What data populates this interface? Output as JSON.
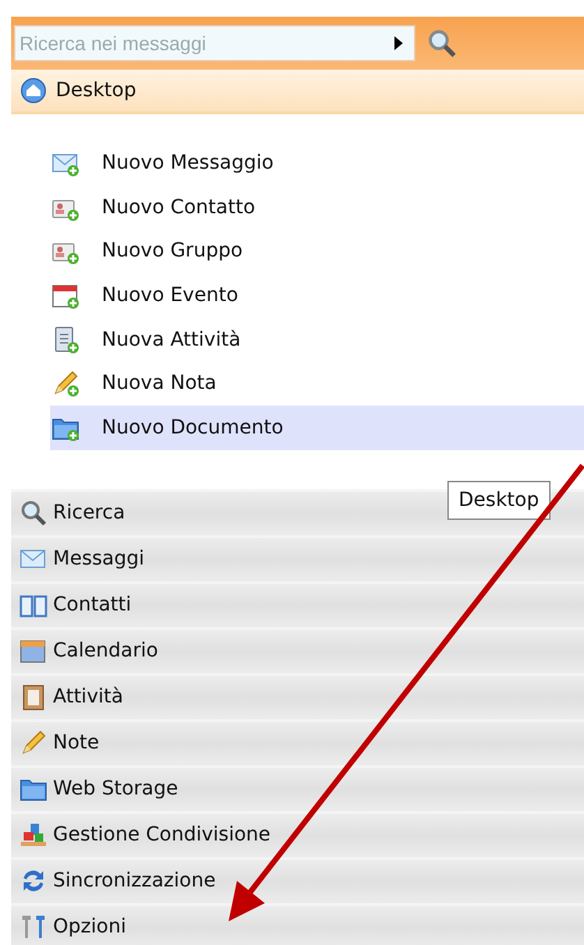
{
  "search": {
    "placeholder": "Ricerca nei messaggi"
  },
  "header": {
    "title": "Desktop"
  },
  "actions": [
    {
      "label": "Nuovo Messaggio",
      "kind": "message",
      "selected": false
    },
    {
      "label": "Nuovo Contatto",
      "kind": "contact",
      "selected": false
    },
    {
      "label": "Nuovo Gruppo",
      "kind": "group",
      "selected": false
    },
    {
      "label": "Nuovo Evento",
      "kind": "event",
      "selected": false
    },
    {
      "label": "Nuova Attività",
      "kind": "task",
      "selected": false
    },
    {
      "label": "Nuova Nota",
      "kind": "note",
      "selected": false
    },
    {
      "label": "Nuovo Documento",
      "kind": "document",
      "selected": true
    }
  ],
  "tooltip": "Desktop",
  "nav": [
    {
      "label": "Ricerca",
      "kind": "search"
    },
    {
      "label": "Messaggi",
      "kind": "mail"
    },
    {
      "label": "Contatti",
      "kind": "book"
    },
    {
      "label": "Calendario",
      "kind": "calendar"
    },
    {
      "label": "Attività",
      "kind": "clipboard"
    },
    {
      "label": "Note",
      "kind": "note"
    },
    {
      "label": "Web Storage",
      "kind": "folder"
    },
    {
      "label": "Gestione Condivisione",
      "kind": "share"
    },
    {
      "label": "Sincronizzazione",
      "kind": "sync"
    },
    {
      "label": "Opzioni",
      "kind": "tools"
    }
  ]
}
